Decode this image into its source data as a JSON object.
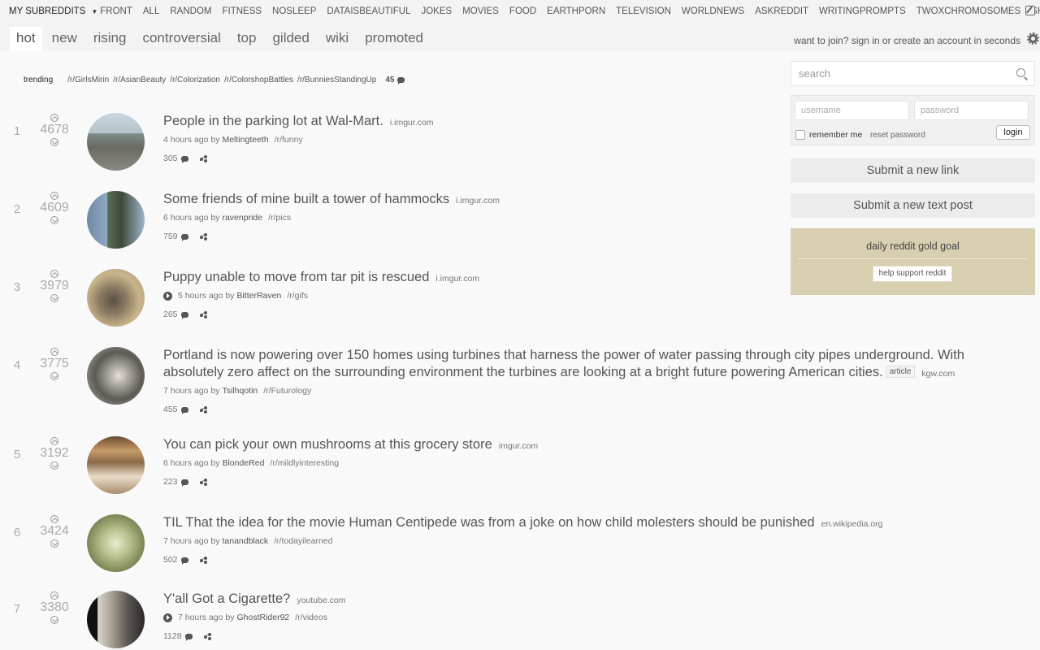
{
  "srbar": {
    "my_subreddits": "MY SUBREDDITS",
    "items": [
      "FRONT",
      "ALL",
      "RANDOM",
      "FITNESS",
      "NOSLEEP",
      "DATAISBEAUTIFUL",
      "JOKES",
      "MOVIES",
      "FOOD",
      "EARTHPORN",
      "TELEVISION",
      "WORLDNEWS",
      "ASKREDDIT",
      "WRITINGPROMPTS",
      "TWOXCHROMOSOMES",
      "SHOWERTHOUGHTS"
    ]
  },
  "tabs": [
    "hot",
    "new",
    "rising",
    "controversial",
    "top",
    "gilded",
    "wiki",
    "promoted"
  ],
  "active_tab": "hot",
  "join_text": "want to join? sign in or create an account in seconds",
  "trending": {
    "label": "trending",
    "items": [
      "/r/GirlsMirin",
      "/r/AsianBeauty",
      "/r/Colorization",
      "/r/ColorshopBattles",
      "/r/BunniesStandingUp"
    ],
    "count": "45"
  },
  "posts": [
    {
      "rank": "1",
      "score": "4678",
      "title": "People in the parking lot at Wal-Mart.",
      "flair": "",
      "domain": "i.imgur.com",
      "time": "4 hours ago by",
      "author": "Meltingteeth",
      "subreddit": "/r/funny",
      "comments": "305",
      "video": false,
      "thumb": "thumb-parking-lot"
    },
    {
      "rank": "2",
      "score": "4609",
      "title": "Some friends of mine built a tower of hammocks",
      "flair": "",
      "domain": "i.imgur.com",
      "time": "6 hours ago by",
      "author": "ravenpride",
      "subreddit": "/r/pics",
      "comments": "759",
      "video": false,
      "thumb": "thumb-hammocks"
    },
    {
      "rank": "3",
      "score": "3979",
      "title": "Puppy unable to move from tar pit is rescued",
      "flair": "",
      "domain": "i.imgur.com",
      "time": "5 hours ago by",
      "author": "BitterRaven",
      "subreddit": "/r/gifs",
      "comments": "265",
      "video": true,
      "thumb": "thumb-puppy"
    },
    {
      "rank": "4",
      "score": "3775",
      "title": "Portland is now powering over 150 homes using turbines that harness the power of water passing through city pipes underground. With absolutely zero affect on the surrounding environment the turbines are looking at a bright future powering American cities.",
      "flair": "article",
      "domain": "kgw.com",
      "time": "7 hours ago by",
      "author": "Tsilhqotin",
      "subreddit": "/r/Futurology",
      "comments": "455",
      "video": false,
      "thumb": "thumb-turbine"
    },
    {
      "rank": "5",
      "score": "3192",
      "title": "You can pick your own mushrooms at this grocery store",
      "flair": "",
      "domain": "imgur.com",
      "time": "6 hours ago by",
      "author": "BlondeRed",
      "subreddit": "/r/mildlyinteresting",
      "comments": "223",
      "video": false,
      "thumb": "thumb-mushrooms"
    },
    {
      "rank": "6",
      "score": "3424",
      "title": "TIL That the idea for the movie Human Centipede was from a joke on how child molesters should be punished",
      "flair": "",
      "domain": "en.wikipedia.org",
      "time": "7 hours ago by",
      "author": "tanandblack",
      "subreddit": "/r/todayilearned",
      "comments": "502",
      "video": false,
      "thumb": "thumb-forest"
    },
    {
      "rank": "7",
      "score": "3380",
      "title": "Y'all Got a Cigarette?",
      "flair": "",
      "domain": "youtube.com",
      "time": "7 hours ago by",
      "author": "GhostRider92",
      "subreddit": "/r/videos",
      "comments": "1128",
      "video": true,
      "thumb": "thumb-video"
    }
  ],
  "sidebar": {
    "search_placeholder": "search",
    "username_placeholder": "username",
    "password_placeholder": "password",
    "remember_me": "remember me",
    "reset_password": "reset password",
    "login": "login",
    "submit_link": "Submit a new link",
    "submit_text": "Submit a new text post",
    "gold_title": "daily reddit gold goal",
    "gold_button": "help support reddit"
  },
  "colors": {
    "gold_bg": "#d8ceb0",
    "bar_bg": "#f3f3f3",
    "page_bg": "#f9f9f9"
  }
}
